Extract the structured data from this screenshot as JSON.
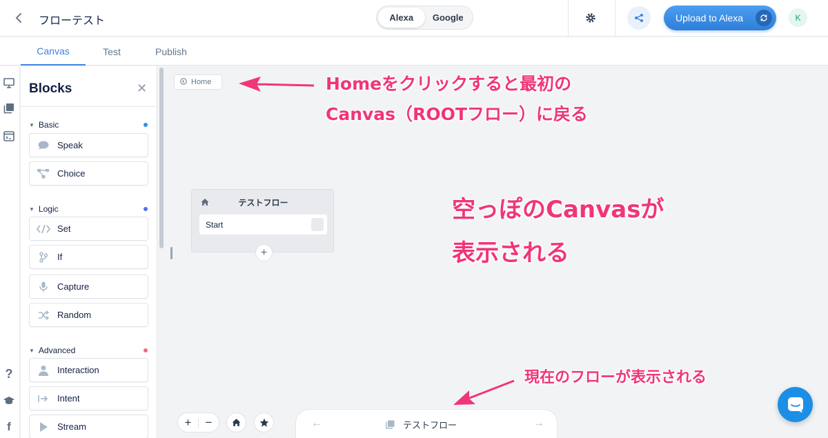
{
  "header": {
    "project_title": "フローテスト",
    "platform_options": [
      "Alexa",
      "Google"
    ],
    "platform_selected": "Alexa",
    "upload_label": "Upload to Alexa",
    "avatar_initial": "K"
  },
  "tabs": [
    {
      "label": "Canvas",
      "active": true
    },
    {
      "label": "Test",
      "active": false
    },
    {
      "label": "Publish",
      "active": false
    }
  ],
  "rail": {
    "top_icons": [
      "monitor-icon",
      "library-icon",
      "terminal-icon"
    ],
    "bottom_icons": [
      "help-icon",
      "graduation-cap-icon",
      "facebook-icon"
    ]
  },
  "blocks_panel": {
    "title": "Blocks",
    "sections": [
      {
        "name": "Basic",
        "dot_color": "#2f8ff0",
        "items": [
          {
            "label": "Speak",
            "icon": "speech-bubble-icon"
          },
          {
            "label": "Choice",
            "icon": "choice-branch-icon"
          }
        ]
      },
      {
        "name": "Logic",
        "dot_color": "#4d6ef0",
        "items": [
          {
            "label": "Set",
            "icon": "code-icon"
          },
          {
            "label": "If",
            "icon": "git-branch-icon"
          },
          {
            "label": "Capture",
            "icon": "microphone-icon"
          },
          {
            "label": "Random",
            "icon": "shuffle-icon"
          }
        ]
      },
      {
        "name": "Advanced",
        "dot_color": "#f06a7e",
        "items": [
          {
            "label": "Interaction",
            "icon": "person-icon"
          },
          {
            "label": "Intent",
            "icon": "intent-arrow-icon"
          },
          {
            "label": "Stream",
            "icon": "play-icon"
          }
        ]
      }
    ]
  },
  "canvas": {
    "home_label": "Home",
    "flow_node": {
      "title": "テストフロー",
      "start_label": "Start"
    }
  },
  "bottom_bar": {
    "current_flow": "テストフロー"
  },
  "annotations": {
    "home_line1": "Homeをクリックすると最初の",
    "home_line2": "Canvas（ROOTフロー）に戻る",
    "empty_line1": "空っぽのCanvasが",
    "empty_line2": "表示される",
    "current_flow_note": "現在のフローが表示される",
    "color": "#f0357a"
  },
  "colors": {
    "accent": "#3d82e0",
    "upload": "#2d7fd9",
    "chat": "#1b8fe6"
  }
}
